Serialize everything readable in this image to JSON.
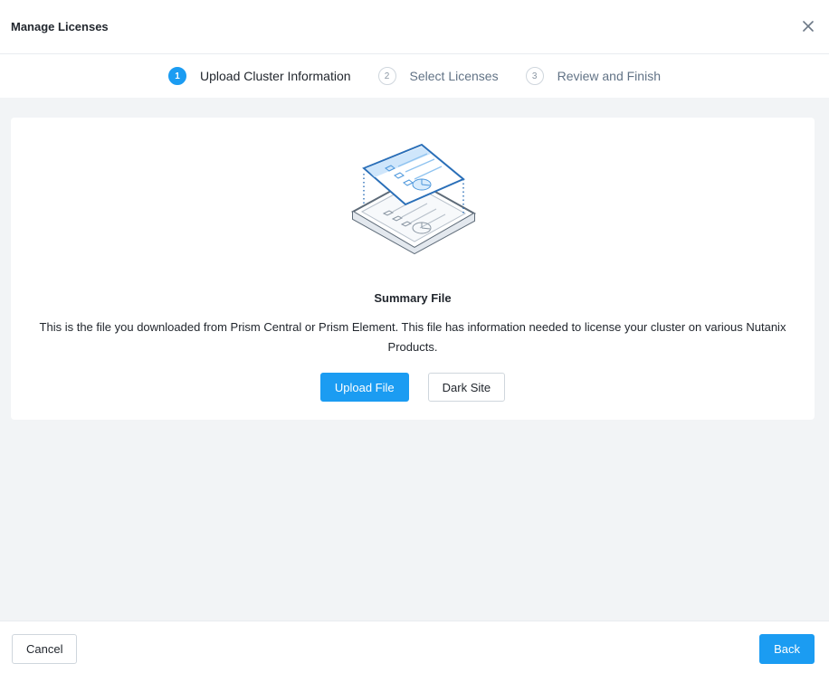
{
  "header": {
    "title": "Manage Licenses",
    "close_icon": "close-icon"
  },
  "stepper": {
    "steps": [
      {
        "number": "1",
        "label": "Upload Cluster Information",
        "active": true
      },
      {
        "number": "2",
        "label": "Select Licenses",
        "active": false
      },
      {
        "number": "3",
        "label": "Review and Finish",
        "active": false
      }
    ]
  },
  "card": {
    "illustration_icon": "summary-file-illustration-icon",
    "title": "Summary File",
    "description": "This is the file you downloaded from Prism Central or Prism Element. This file has information needed to license your cluster on various Nutanix Products.",
    "upload_label": "Upload File",
    "dark_site_label": "Dark Site"
  },
  "footer": {
    "cancel_label": "Cancel",
    "back_label": "Back"
  },
  "colors": {
    "accent": "#1b9cf2",
    "background": "#f2f4f6",
    "text": "#22272e",
    "muted": "#627386"
  }
}
